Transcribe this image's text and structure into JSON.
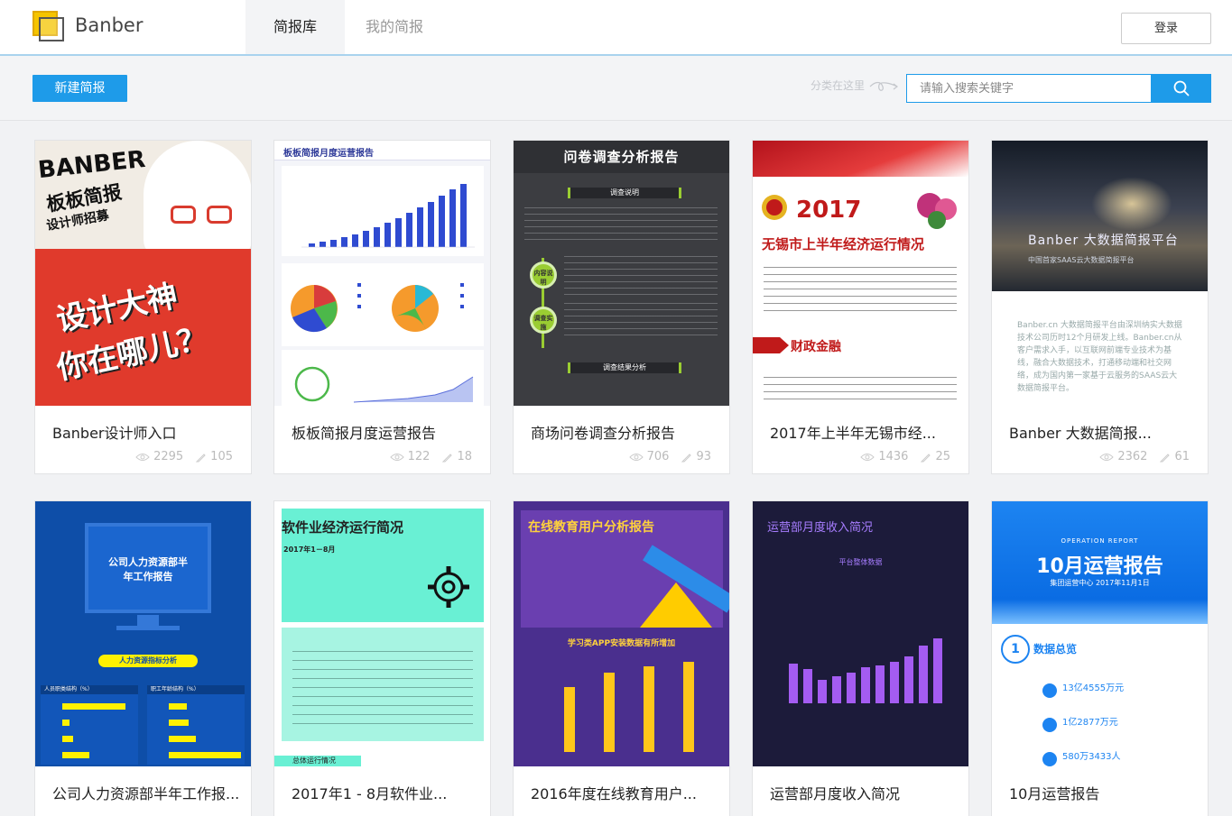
{
  "app": {
    "brand": "Banber"
  },
  "nav": {
    "tabs": [
      {
        "label": "简报库"
      },
      {
        "label": "我的简报"
      }
    ],
    "login_label": "登录"
  },
  "toolbar": {
    "new_label": "新建简报",
    "category_hint": "分类在这里",
    "search_placeholder": "请输入搜索关键字"
  },
  "cards": [
    {
      "title": "Banber设计师入口",
      "views": "2295",
      "likes": "105"
    },
    {
      "title": "板板简报月度运营报告",
      "views": "122",
      "likes": "18"
    },
    {
      "title": "商场问卷调查分析报告",
      "views": "706",
      "likes": "93"
    },
    {
      "title": "2017年上半年无锡市经...",
      "views": "1436",
      "likes": "25"
    },
    {
      "title": "Banber 大数据简报...",
      "views": "2362",
      "likes": "61"
    },
    {
      "title": "公司人力资源部半年工作报..."
    },
    {
      "title": "2017年1 - 8月软件业..."
    },
    {
      "title": "2016年度在线教育用户..."
    },
    {
      "title": "运营部月度收入简况"
    },
    {
      "title": "10月运营报告"
    }
  ],
  "thumbs": {
    "t1": {
      "a": "BANBER",
      "b": "板板简报",
      "c": "设计师招募",
      "d": "设计大神",
      "e": "你在哪儿？"
    },
    "t2": {
      "head": "板板简报月度运营报告"
    },
    "t3": {
      "head": "问卷调查分析报告",
      "s1": "调查说明",
      "s2": "调查结果分析",
      "dot1": "内容说明",
      "dot2": "调查实施"
    },
    "t4": {
      "year": "2017",
      "title": "无锡市上半年经济运行情况",
      "sect": "财政金融"
    },
    "t5": {
      "title": "Banber 大数据简报平台",
      "sub": "中国首家SAAS云大数据简报平台",
      "para": "Banber.cn 大数据简报平台由深圳纳实大数据技术公司历时12个月研发上线。Banber.cn从客户需求入手，以互联网前端专业技术为基线，融合大数据技术，打通移动端和社交网络，成为国内第一家基于云服务的SAAS云大数据简报平台。"
    },
    "t6": {
      "title": "公司人力资源部半年工作报告",
      "sec": "人力资源指标分析",
      "c1": "人员职类结构（%）",
      "c2": "职工年龄结构（%）"
    },
    "t7": {
      "title": "软件业经济运行简况",
      "date": "2017年1－8月",
      "foot": "总体运行情况"
    },
    "t8": {
      "title": "在线教育用户分析报告",
      "sub": "学习类APP安装数据有所增加"
    },
    "t9": {
      "title": "运营部月度收入简况",
      "sub": "平台整体数据"
    },
    "t10": {
      "op": "OPERATION REPORT",
      "title": "10月运营报告",
      "sub": "集团运营中心 2017年11月1日",
      "n": "1",
      "lbl": "数据总览",
      "v1": "13亿4555万元",
      "v2": "1亿2877万元",
      "v3": "580万3433人"
    }
  }
}
